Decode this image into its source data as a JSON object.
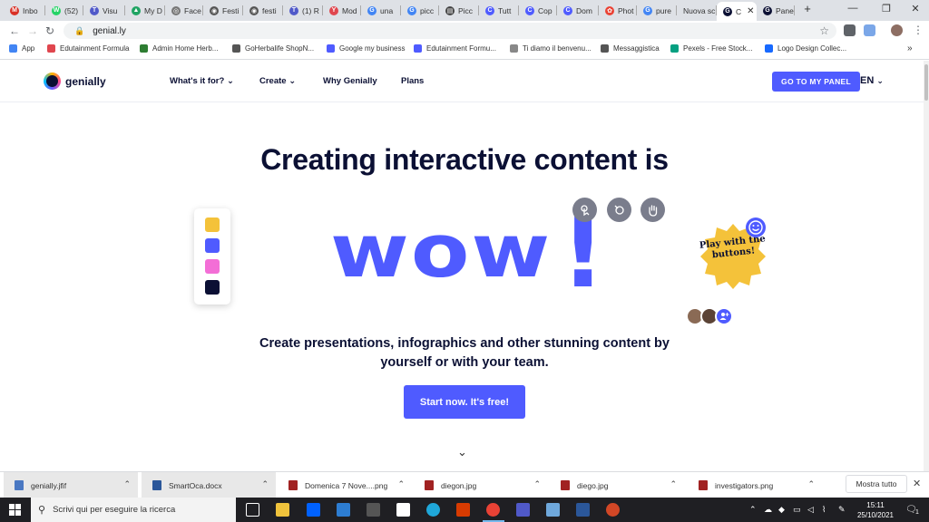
{
  "browser": {
    "tabs": [
      {
        "label": "Inbo",
        "color": "#d93025",
        "glyph": "M"
      },
      {
        "label": "(52) ",
        "color": "#25d366",
        "glyph": "W"
      },
      {
        "label": "Visu",
        "color": "#5059c9",
        "glyph": "T"
      },
      {
        "label": "My D",
        "color": "#1fa463",
        "glyph": "▲"
      },
      {
        "label": "Face",
        "color": "#777777",
        "glyph": "◎"
      },
      {
        "label": "Festi",
        "color": "#555555",
        "glyph": "◉"
      },
      {
        "label": "festi",
        "color": "#555555",
        "glyph": "◉"
      },
      {
        "label": "(1) R",
        "color": "#5059c9",
        "glyph": "T"
      },
      {
        "label": "Mod",
        "color": "#e0464e",
        "glyph": "Y"
      },
      {
        "label": "una",
        "color": "#4285f4",
        "glyph": "G"
      },
      {
        "label": "picc",
        "color": "#4285f4",
        "glyph": "G"
      },
      {
        "label": "Picc",
        "color": "#444444",
        "glyph": "▤"
      },
      {
        "label": "Tutt",
        "color": "#4f5bff",
        "glyph": "C"
      },
      {
        "label": "Cop",
        "color": "#4f5bff",
        "glyph": "C"
      },
      {
        "label": "Dom",
        "color": "#4f5bff",
        "glyph": "C"
      },
      {
        "label": "Phot",
        "color": "#ea4335",
        "glyph": "✿"
      },
      {
        "label": "pure",
        "color": "#4285f4",
        "glyph": "G"
      },
      {
        "label": "Nuova sc",
        "color": "",
        "glyph": ""
      },
      {
        "label": "C",
        "color": "#0b1034",
        "glyph": "G"
      },
      {
        "label": "Pane",
        "color": "#0b1034",
        "glyph": "G"
      }
    ],
    "new_tab": "+",
    "window_controls": {
      "minimize": "—",
      "maximize": "❐",
      "close": "✕"
    },
    "url": "genial.ly",
    "bookmarks": [
      {
        "label": "App",
        "color": "#4285f4"
      },
      {
        "label": "Edutainment Formula",
        "color": "#e0464e"
      },
      {
        "label": "Admin Home Herb...",
        "color": "#2e7d32"
      },
      {
        "label": "GoHerbalife ShopN...",
        "color": "#555555"
      },
      {
        "label": "Google my business",
        "color": "#4f5bff"
      },
      {
        "label": "Edutainment Formu...",
        "color": "#4f5bff"
      },
      {
        "label": "Ti diamo il benvenu...",
        "color": "#888888"
      },
      {
        "label": "Messaggistica",
        "color": "#555555"
      },
      {
        "label": "Pexels - Free Stock...",
        "color": "#05a081"
      },
      {
        "label": "Logo Design Collec...",
        "color": "#1769ff"
      }
    ],
    "bookmarks_more": "»"
  },
  "site": {
    "logo_text": "genially",
    "nav": [
      {
        "label": "What's it for?",
        "chevron": "⌄"
      },
      {
        "label": "Create",
        "chevron": "⌄"
      },
      {
        "label": "Why Genially",
        "chevron": ""
      },
      {
        "label": "Plans",
        "chevron": ""
      }
    ],
    "cta_label": "GO TO MY PANEL",
    "lang_label": "EN",
    "lang_chevron": "⌄"
  },
  "hero": {
    "headline": "Creating interactive content is",
    "wow": "wow",
    "exclamation": "!",
    "badge_text": "Play with the buttons!",
    "subtitle": "Create presentations, infographics and other stunning content by yourself or with your team.",
    "start_label": "Start now. It's free!",
    "scroll_chevron": "⌄",
    "palette_colors": [
      "#f4c23a",
      "#4f5bff",
      "#f36ed6",
      "#0b1034"
    ],
    "accent": "#4f5bff",
    "dark": "#0b1034"
  },
  "downloads": {
    "items": [
      {
        "name": "genially.jfif",
        "color": "#4a78c2",
        "grey": true
      },
      {
        "name": "SmartOca.docx",
        "color": "#2b579a",
        "grey": true
      },
      {
        "name": "Domenica 7 Nove....png",
        "color": "#a12222",
        "grey": false
      },
      {
        "name": "diegon.jpg",
        "color": "#a12222",
        "grey": false
      },
      {
        "name": "diego.jpg",
        "color": "#a12222",
        "grey": false
      },
      {
        "name": "investigators.png",
        "color": "#a12222",
        "grey": false
      }
    ],
    "show_all": "Mostra tutto",
    "close": "✕"
  },
  "taskbar": {
    "search_placeholder": "Scrivi qui per eseguire la ricerca",
    "time": "15:11",
    "date": "25/10/2021",
    "notifications": "1"
  }
}
